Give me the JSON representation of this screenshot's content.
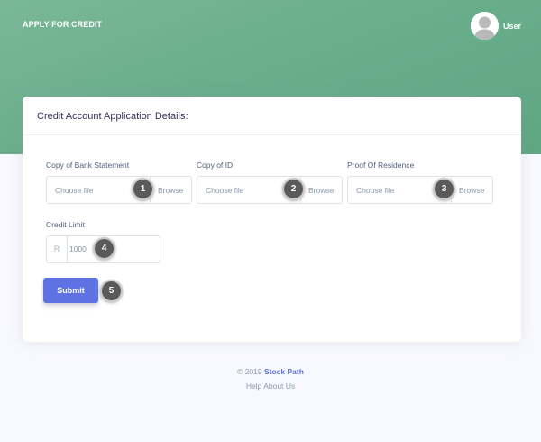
{
  "header": {
    "brand": "APPLY FOR CREDIT",
    "user_label": "User"
  },
  "card": {
    "title": "Credit Account Application Details:",
    "fields": [
      {
        "label": "Copy of Bank Statement",
        "placeholder": "Choose file",
        "button": "Browse",
        "badge": "1"
      },
      {
        "label": "Copy of ID",
        "placeholder": "Choose file",
        "button": "Browse",
        "badge": "2"
      },
      {
        "label": "Proof Of Residence",
        "placeholder": "Choose file",
        "button": "Browse",
        "badge": "3"
      }
    ],
    "credit_limit": {
      "label": "Credit Limit",
      "prefix": "R",
      "value": "1000",
      "badge": "4"
    },
    "submit": {
      "label": "Submit",
      "badge": "5"
    }
  },
  "footer": {
    "copyright": "© 2019",
    "brand_link": "Stock Path",
    "links": [
      "Help",
      "About Us"
    ]
  },
  "colors": {
    "hero_green": "#6aae8c",
    "primary": "#5e72e4",
    "badge": "#5a5a5a"
  }
}
